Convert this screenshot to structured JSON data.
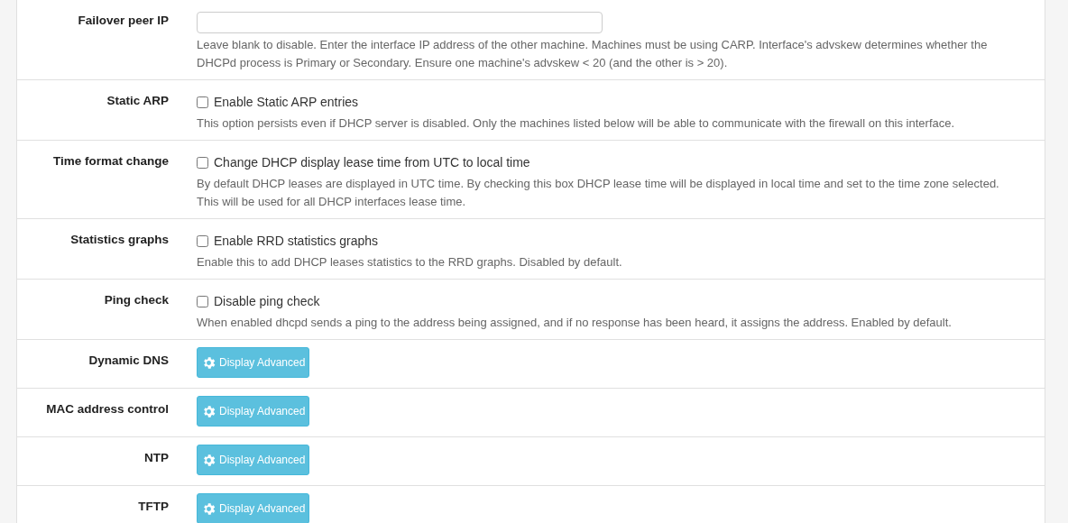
{
  "rows": [
    {
      "kind": "text_input",
      "label": "Failover peer IP",
      "value": "",
      "help": "Leave blank to disable. Enter the interface IP address of the other machine. Machines must be using CARP. Interface's advskew determines whether the DHCPd process is Primary or Secondary. Ensure one machine's advskew < 20 (and the other is > 20)."
    },
    {
      "kind": "checkbox",
      "label": "Static ARP",
      "option": "Enable Static ARP entries",
      "checked": false,
      "help": "This option persists even if DHCP server is disabled. Only the machines listed below will be able to communicate with the firewall on this interface."
    },
    {
      "kind": "checkbox",
      "label": "Time format change",
      "option": "Change DHCP display lease time from UTC to local time",
      "checked": false,
      "help": "By default DHCP leases are displayed in UTC time. By checking this box DHCP lease time will be displayed in local time and set to the time zone selected. This will be used for all DHCP interfaces lease time."
    },
    {
      "kind": "checkbox",
      "label": "Statistics graphs",
      "option": "Enable RRD statistics graphs",
      "checked": false,
      "help": "Enable this to add DHCP leases statistics to the RRD graphs. Disabled by default."
    },
    {
      "kind": "checkbox",
      "label": "Ping check",
      "option": "Disable ping check",
      "checked": false,
      "help": "When enabled dhcpd sends a ping to the address being assigned, and if no response has been heard, it assigns the address. Enabled by default."
    },
    {
      "kind": "button",
      "label": "Dynamic DNS",
      "button": "Display Advanced"
    },
    {
      "kind": "button",
      "label": "MAC address control",
      "button": "Display Advanced"
    },
    {
      "kind": "button",
      "label": "NTP",
      "button": "Display Advanced"
    },
    {
      "kind": "button",
      "label": "TFTP",
      "button": "Display Advanced"
    }
  ]
}
